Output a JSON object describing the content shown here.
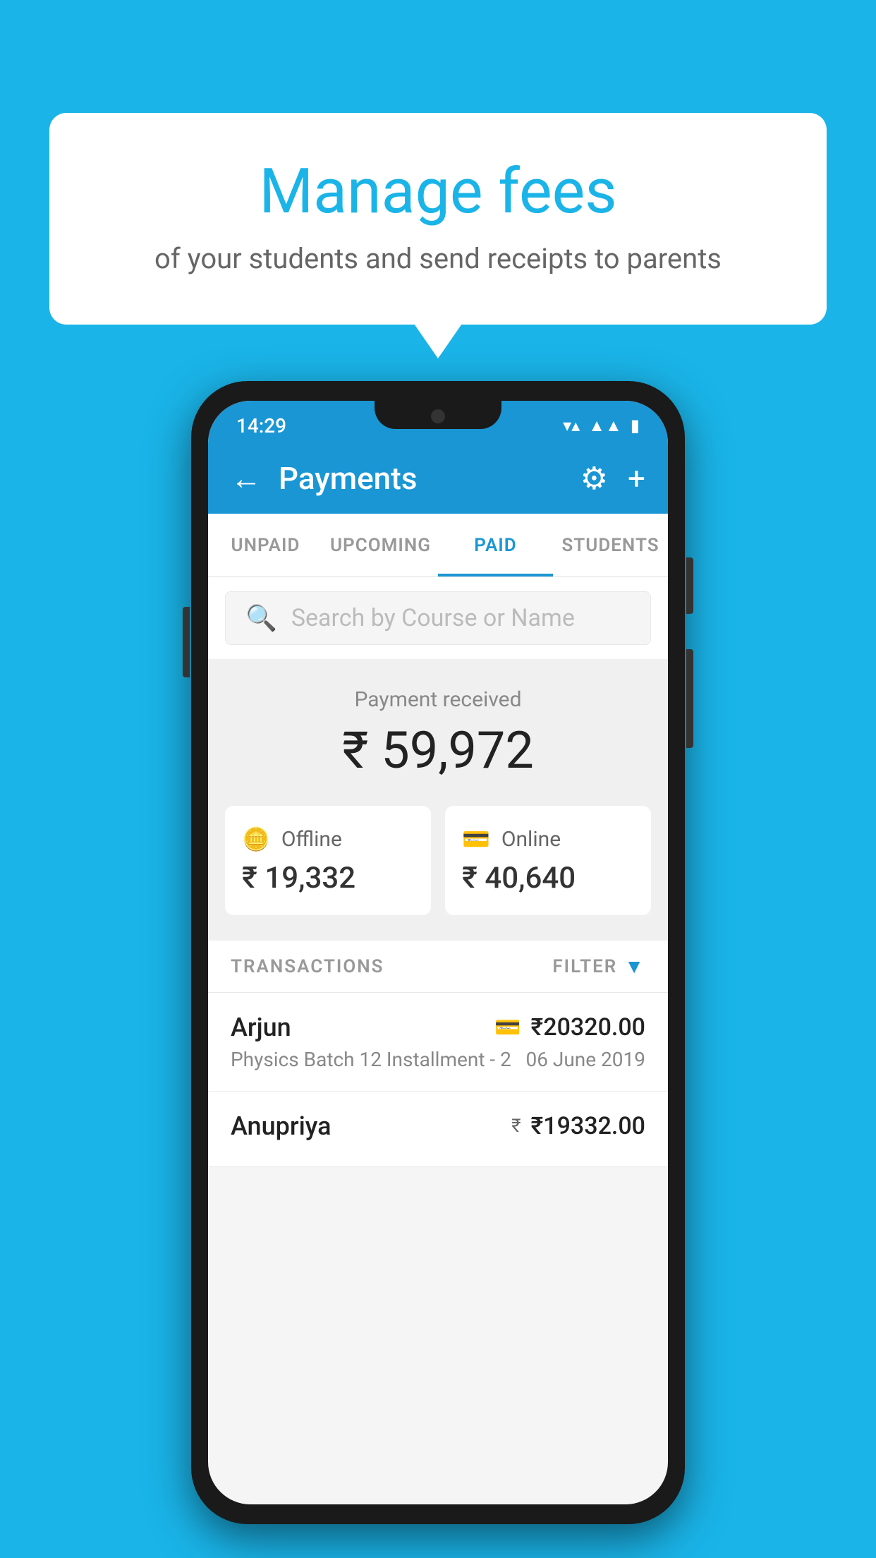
{
  "background_color": "#1ab4e8",
  "speech_bubble": {
    "title": "Manage fees",
    "subtitle": "of your students and send receipts to parents"
  },
  "status_bar": {
    "time": "14:29",
    "wifi": "▼",
    "signal": "▲",
    "battery": "▮"
  },
  "app_bar": {
    "title": "Payments",
    "back_label": "←",
    "settings_label": "⚙",
    "add_label": "+"
  },
  "tabs": [
    {
      "label": "UNPAID",
      "active": false
    },
    {
      "label": "UPCOMING",
      "active": false
    },
    {
      "label": "PAID",
      "active": true
    },
    {
      "label": "STUDENTS",
      "active": false
    }
  ],
  "search": {
    "placeholder": "Search by Course or Name"
  },
  "payment_summary": {
    "label": "Payment received",
    "amount": "₹ 59,972",
    "offline": {
      "label": "Offline",
      "amount": "₹ 19,332"
    },
    "online": {
      "label": "Online",
      "amount": "₹ 40,640"
    }
  },
  "transactions": {
    "header": "TRANSACTIONS",
    "filter": "FILTER",
    "items": [
      {
        "name": "Arjun",
        "course": "Physics Batch 12 Installment - 2",
        "amount": "₹20320.00",
        "date": "06 June 2019",
        "payment_type": "card"
      },
      {
        "name": "Anupriya",
        "course": "",
        "amount": "₹19332.00",
        "date": "",
        "payment_type": "cash"
      }
    ]
  }
}
